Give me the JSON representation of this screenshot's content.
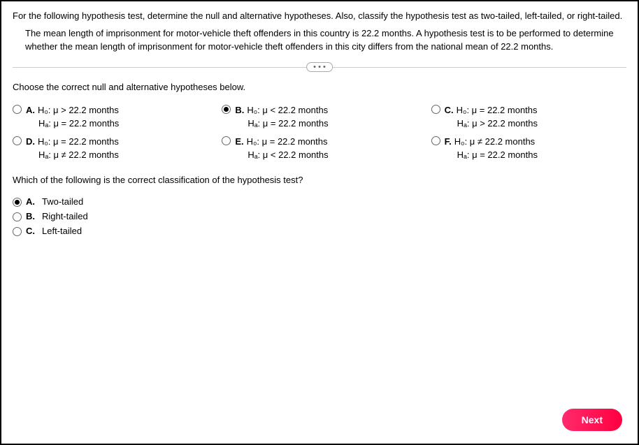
{
  "question": {
    "main": "For the following hypothesis test, determine the null and alternative hypotheses. Also, classify the hypothesis test as two-tailed, left-tailed, or right-tailed.",
    "sub": "The mean length of imprisonment for motor-vehicle theft offenders in this country is 22.2 months. A hypothesis test is to be performed to determine whether the mean length of imprisonment for motor-vehicle theft offenders in this city differs from the national mean of 22.2 months."
  },
  "ellipsis": "• • •",
  "prompt1": "Choose the correct null and alternative hypotheses below.",
  "hypotheses": {
    "a": {
      "letter": "A.",
      "h0": "H₀: μ > 22.2 months",
      "ha": "Hₐ: μ = 22.2 months",
      "selected": false
    },
    "b": {
      "letter": "B.",
      "h0": "H₀: μ < 22.2 months",
      "ha": "Hₐ: μ = 22.2 months",
      "selected": true
    },
    "c": {
      "letter": "C.",
      "h0": "H₀: μ = 22.2 months",
      "ha": "Hₐ: μ > 22.2 months",
      "selected": false
    },
    "d": {
      "letter": "D.",
      "h0": "H₀: μ = 22.2 months",
      "ha": "Hₐ: μ ≠ 22.2 months",
      "selected": false
    },
    "e": {
      "letter": "E.",
      "h0": "H₀: μ = 22.2 months",
      "ha": "Hₐ: μ < 22.2 months",
      "selected": false
    },
    "f": {
      "letter": "F.",
      "h0": "H₀: μ ≠ 22.2 months",
      "ha": "Hₐ: μ = 22.2 months",
      "selected": false
    }
  },
  "prompt2": "Which of the following is the correct classification of the hypothesis test?",
  "classify": {
    "a": {
      "letter": "A.",
      "label": "Two-tailed",
      "selected": true
    },
    "b": {
      "letter": "B.",
      "label": "Right-tailed",
      "selected": false
    },
    "c": {
      "letter": "C.",
      "label": "Left-tailed",
      "selected": false
    }
  },
  "next_label": "Next"
}
